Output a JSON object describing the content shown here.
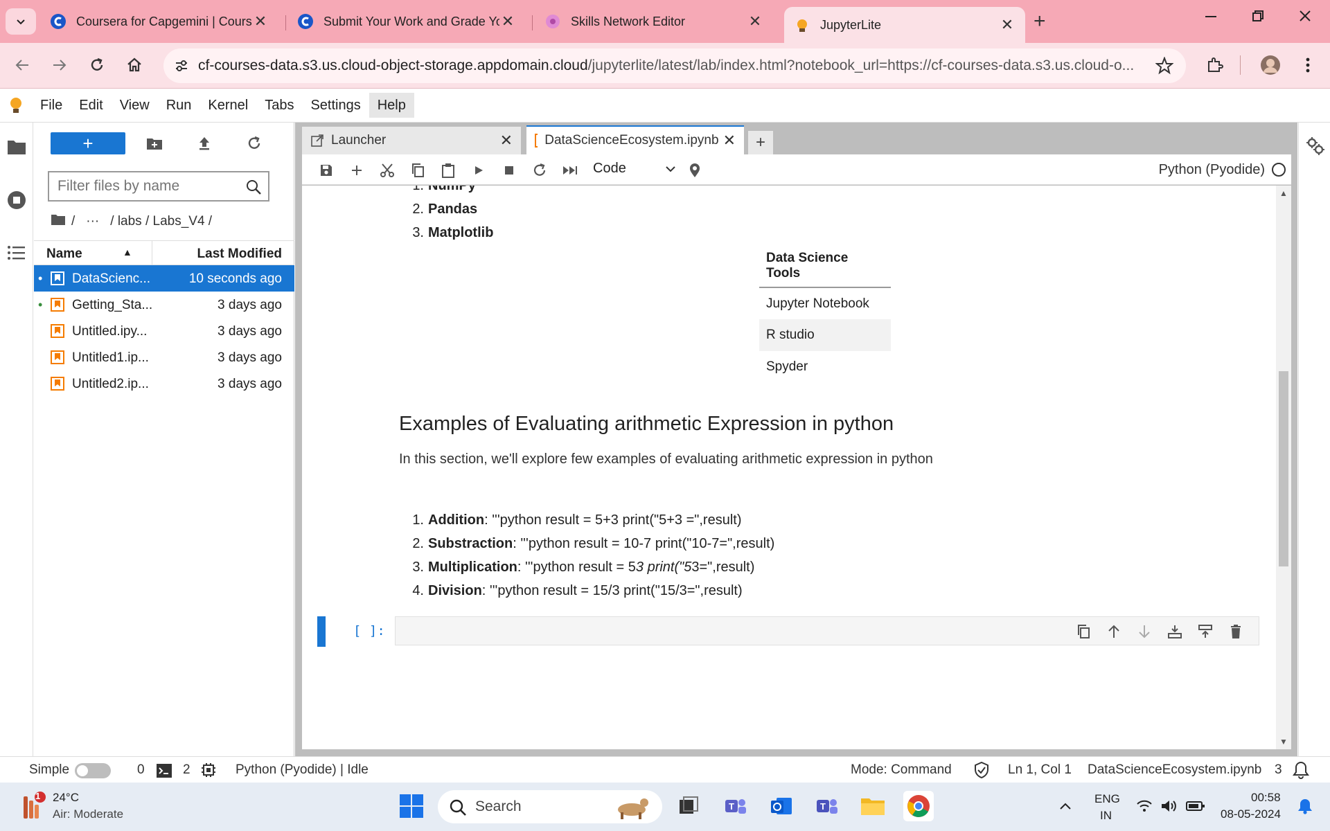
{
  "browser": {
    "tabs": [
      {
        "title": "Coursera for Capgemini | Cours",
        "icon": "coursera-icon"
      },
      {
        "title": "Submit Your Work and Grade Yo",
        "icon": "coursera-icon"
      },
      {
        "title": "Skills Network Editor",
        "icon": "skills-network-icon"
      },
      {
        "title": "JupyterLite",
        "icon": "jupyter-icon"
      }
    ],
    "url_host": "cf-courses-data.s3.us.cloud-object-storage.appdomain.cloud",
    "url_path": "/jupyterlite/latest/lab/index.html?notebook_url=https://cf-courses-data.s3.us.cloud-o..."
  },
  "menu": [
    "File",
    "Edit",
    "View",
    "Run",
    "Kernel",
    "Tabs",
    "Settings",
    "Help"
  ],
  "filebrowser": {
    "new_label": "+",
    "filter_placeholder": "Filter files by name",
    "breadcrumbs": [
      "/",
      "···",
      "/ labs / Labs_V4 /"
    ],
    "col_name": "Name",
    "col_modified": "Last Modified",
    "files": [
      {
        "name": "DataScienc...",
        "modified": "10 seconds ago",
        "running": true,
        "selected": true
      },
      {
        "name": "Getting_Sta...",
        "modified": "3 days ago",
        "running": true,
        "selected": false
      },
      {
        "name": "Untitled.ipy...",
        "modified": "3 days ago",
        "running": false,
        "selected": false
      },
      {
        "name": "Untitled1.ip...",
        "modified": "3 days ago",
        "running": false,
        "selected": false
      },
      {
        "name": "Untitled2.ip...",
        "modified": "3 days ago",
        "running": false,
        "selected": false
      }
    ]
  },
  "doc_tabs": [
    {
      "title": "Launcher"
    },
    {
      "title": "DataScienceEcosystem.ipynb"
    }
  ],
  "notebook_toolbar": {
    "cell_type": "Code",
    "kernel": "Python (Pyodide)"
  },
  "notebook": {
    "libraries": [
      {
        "num": "1.",
        "text": "NumPy"
      },
      {
        "num": "2.",
        "text": "Pandas"
      },
      {
        "num": "3.",
        "text": "Matplotlib"
      }
    ],
    "tools_table": {
      "header": "Data Science Tools",
      "rows": [
        "Jupyter Notebook",
        "R studio",
        "Spyder"
      ]
    },
    "heading": "Examples of Evaluating arithmetic Expression in python",
    "intro": "In this section, we'll explore few examples of evaluating arithmetic expression in python",
    "examples": [
      {
        "num": "1.",
        "label": "Addition",
        "prefix": ": '''python result = 5+3 print(\"5+3 =\",result)",
        "italic": "",
        "suffix": ""
      },
      {
        "num": "2.",
        "label": "Substraction",
        "prefix": ": '''python result = 10-7 print(\"10-7=\",result)",
        "italic": "",
        "suffix": ""
      },
      {
        "num": "3.",
        "label": "Multiplication",
        "prefix": ": '''python result = 5",
        "italic": "3 print(\"5",
        "suffix": "3=\",result)"
      },
      {
        "num": "4.",
        "label": "Division",
        "prefix": ": '''python result = 15/3 print(\"15/3=\",result)",
        "italic": "",
        "suffix": ""
      }
    ],
    "cell_prompt": "[ ]:"
  },
  "statusbar": {
    "simple": "Simple",
    "terminals": "0",
    "kernels": "2",
    "kernel_status": "Python (Pyodide) | Idle",
    "mode": "Mode: Command",
    "position": "Ln 1, Col 1",
    "filename": "DataScienceEcosystem.ipynb",
    "notifications": "3"
  },
  "taskbar": {
    "weather_temp": "24°C",
    "weather_desc": "Air: Moderate",
    "weather_badge": "1",
    "search": "Search",
    "lang_top": "ENG",
    "lang_bottom": "IN",
    "time": "00:58",
    "date": "08-05-2024"
  },
  "colors": {
    "accent": "#1976d2",
    "tabstrip": "#f6a9b6",
    "toolbar": "#fbe1e6"
  }
}
